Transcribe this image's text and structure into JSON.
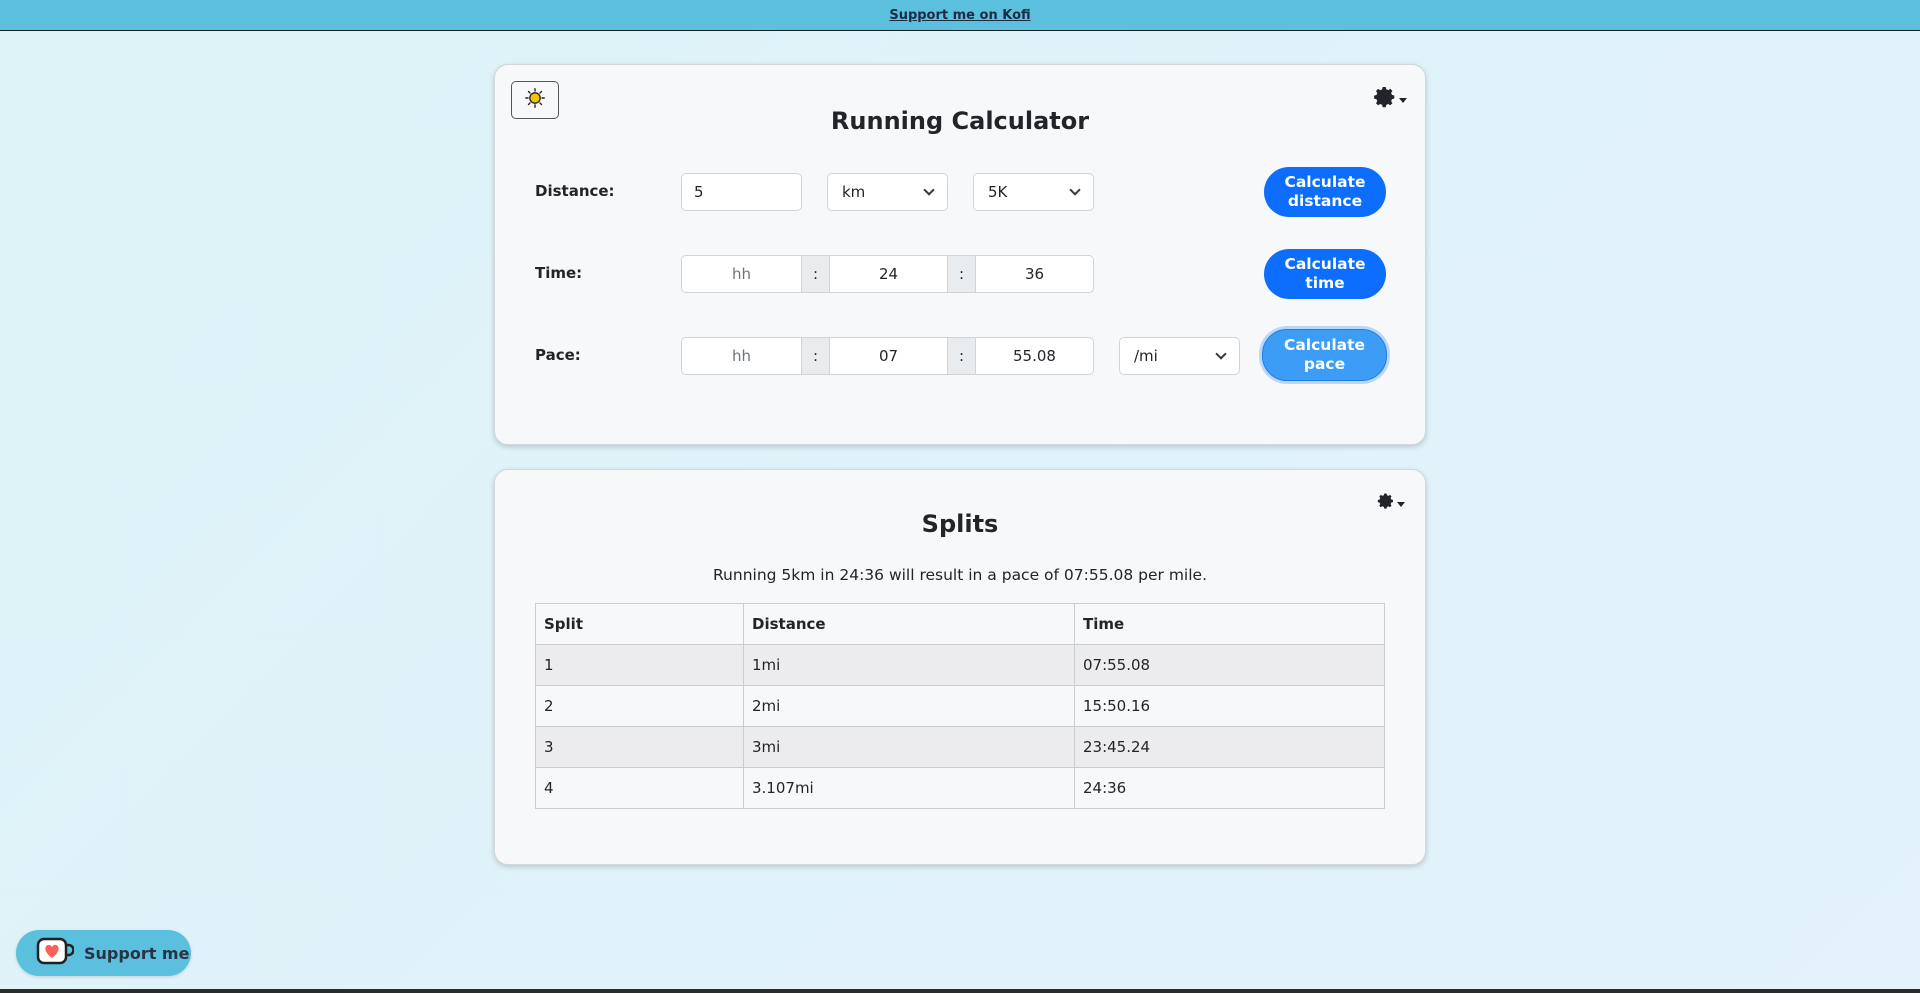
{
  "topbar": {
    "link_label": "Support me on Kofi"
  },
  "calculator": {
    "title": "Running Calculator",
    "distance": {
      "label": "Distance:",
      "value": "5",
      "unit": "km",
      "preset": "5K",
      "button": "Calculate distance"
    },
    "time": {
      "label": "Time:",
      "hh_placeholder": "hh",
      "mm": "24",
      "ss": "36",
      "separator": ":",
      "button": "Calculate time"
    },
    "pace": {
      "label": "Pace:",
      "hh_placeholder": "hh",
      "mm": "07",
      "ss": "55.08",
      "separator": ":",
      "unit": "/mi",
      "button": "Calculate pace"
    }
  },
  "splits": {
    "title": "Splits",
    "summary": "Running 5km in 24:36 will result in a pace of 07:55.08 per mile.",
    "columns": [
      "Split",
      "Distance",
      "Time"
    ],
    "rows": [
      [
        "1",
        "1mi",
        "07:55.08"
      ],
      [
        "2",
        "2mi",
        "15:50.16"
      ],
      [
        "3",
        "3mi",
        "23:45.24"
      ],
      [
        "4",
        "3.107mi",
        "24:36"
      ]
    ]
  },
  "kofi_button": {
    "label": "Support me"
  },
  "icons": {
    "theme": "sun-icon",
    "settings": "gear-icon",
    "kofi": "kofi-cup-icon"
  },
  "colors": {
    "primary": "#0d6efd",
    "topbar": "#5bc0de"
  }
}
